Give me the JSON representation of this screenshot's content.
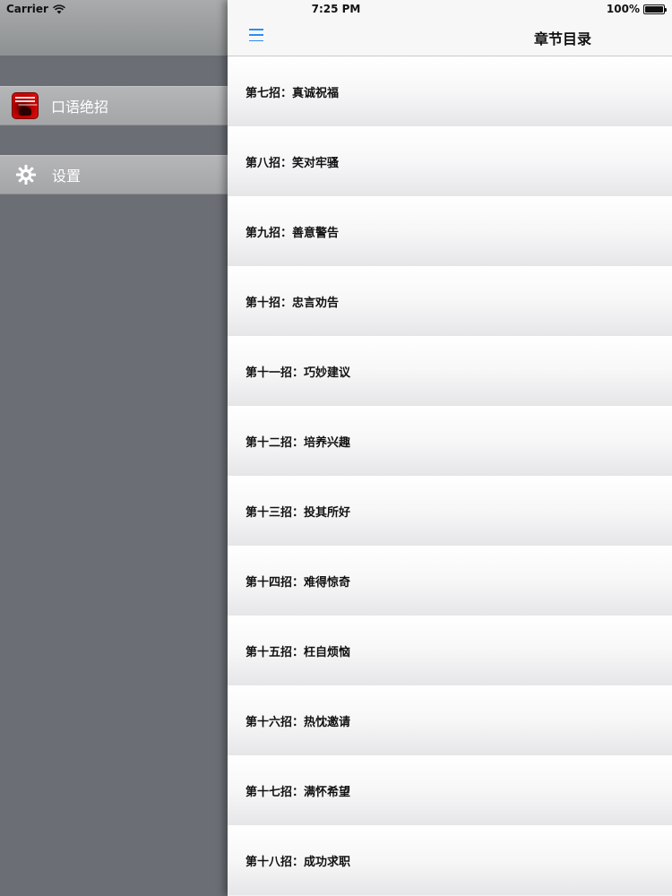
{
  "status_bar": {
    "carrier": "Carrier",
    "time": "7:25 PM",
    "battery": "100%"
  },
  "side_menu": {
    "items": [
      {
        "label": "口语绝招",
        "icon": "app-icon"
      },
      {
        "label": "设置",
        "icon": "gear-icon"
      }
    ]
  },
  "nav": {
    "title": "章节目录",
    "menu_icon": "hamburger-icon",
    "accent_color": "#2d8cf0"
  },
  "chapters": [
    "第七招：真诚祝福",
    "第八招：笑对牢骚",
    "第九招：善意警告",
    "第十招：忠言劝告",
    "第十一招：巧妙建议",
    "第十二招：培养兴趣",
    "第十三招：投其所好",
    "第十四招：难得惊奇",
    "第十五招：枉自烦恼",
    "第十六招：热忱邀请",
    "第十七招：满怀希望",
    "第十八招：成功求职"
  ]
}
